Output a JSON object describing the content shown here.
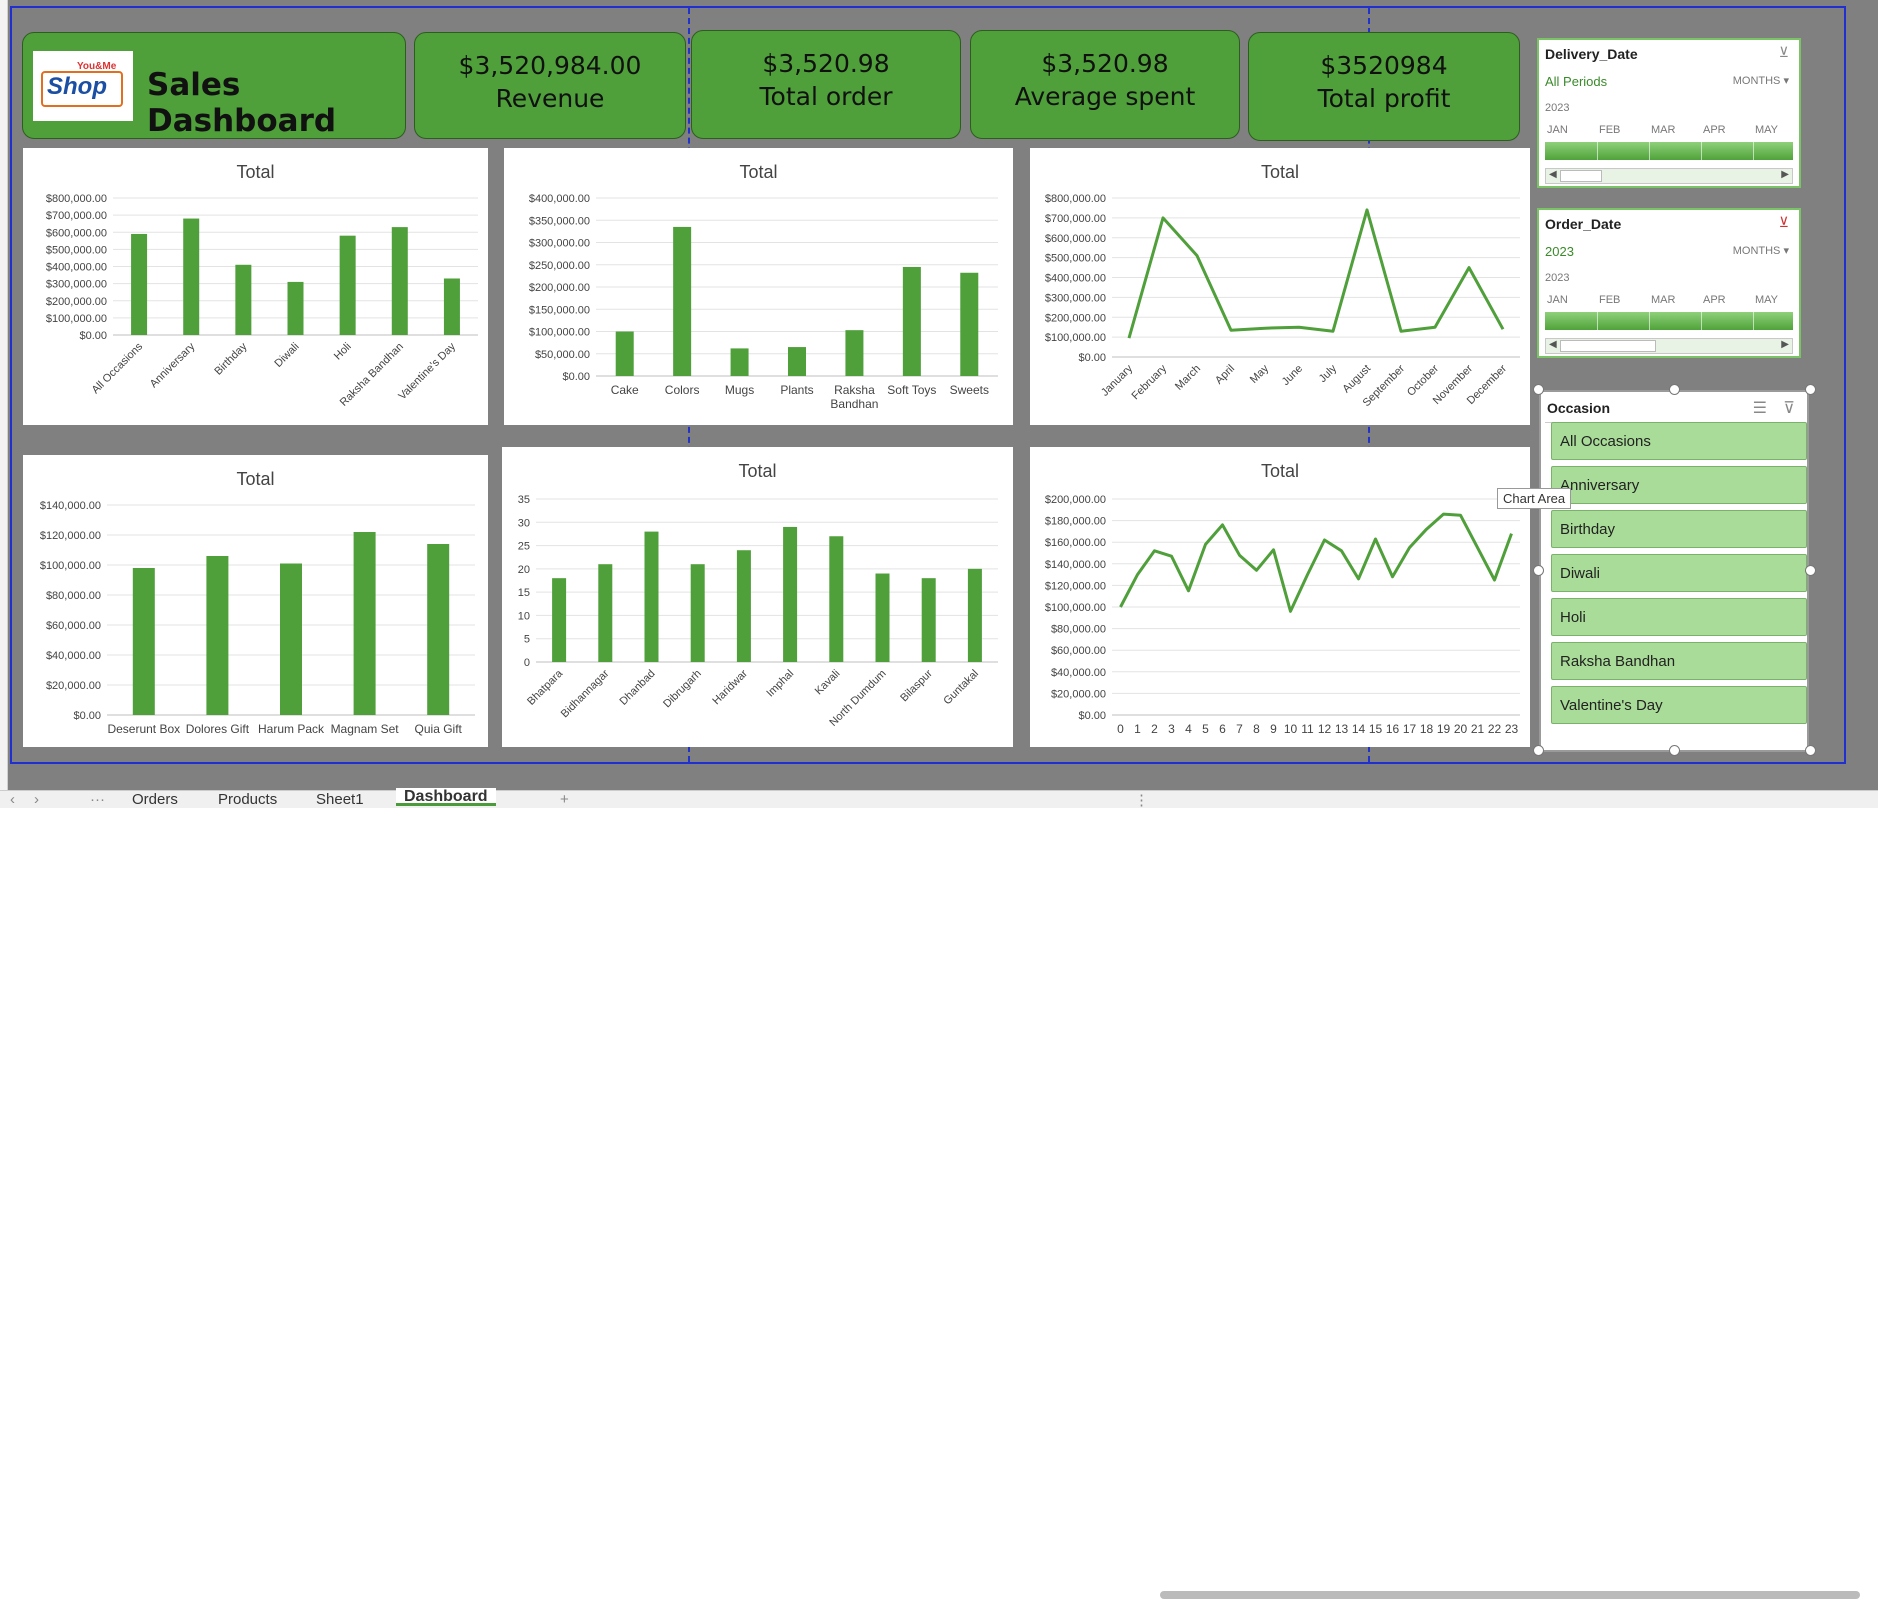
{
  "header": {
    "title": "Sales Dashboard",
    "logo_text_small": "You&Me",
    "logo_text": "Shop",
    "kpis": [
      {
        "value": "$3,520,984.00",
        "label": "Revenue"
      },
      {
        "value": "$3,520.98",
        "label": "Total order"
      },
      {
        "value": "$3,520.98",
        "label": "Average spent"
      },
      {
        "value": "$3520984",
        "label": "Total profit"
      }
    ]
  },
  "chart_data": [
    {
      "type": "bar",
      "title": "Total",
      "categories": [
        "All Occasions",
        "Anniversary",
        "Birthday",
        "Diwali",
        "Holi",
        "Raksha Bandhan",
        "Valentine's Day"
      ],
      "values": [
        590000,
        680000,
        410000,
        310000,
        580000,
        630000,
        330000
      ],
      "ylim": [
        0,
        800000
      ],
      "yticks": [
        "$0.00",
        "$100,000.00",
        "$200,000.00",
        "$300,000.00",
        "$400,000.00",
        "$500,000.00",
        "$600,000.00",
        "$700,000.00",
        "$800,000.00"
      ],
      "color": "#4f9f3a"
    },
    {
      "type": "bar",
      "title": "Total",
      "categories": [
        "Cake",
        "Colors",
        "Mugs",
        "Plants",
        "Raksha Bandhan",
        "Soft Toys",
        "Sweets"
      ],
      "values": [
        100000,
        335000,
        62000,
        65000,
        103000,
        245000,
        232000
      ],
      "ylim": [
        0,
        400000
      ],
      "yticks": [
        "$0.00",
        "$50,000.00",
        "$100,000.00",
        "$150,000.00",
        "$200,000.00",
        "$250,000.00",
        "$300,000.00",
        "$350,000.00",
        "$400,000.00"
      ],
      "color": "#4f9f3a"
    },
    {
      "type": "line",
      "title": "Total",
      "categories": [
        "January",
        "February",
        "March",
        "April",
        "May",
        "June",
        "July",
        "August",
        "September",
        "October",
        "November",
        "December"
      ],
      "values": [
        95000,
        700000,
        510000,
        135000,
        145000,
        150000,
        130000,
        740000,
        130000,
        150000,
        450000,
        140000
      ],
      "ylim": [
        0,
        800000
      ],
      "yticks": [
        "$0.00",
        "$100,000.00",
        "$200,000.00",
        "$300,000.00",
        "$400,000.00",
        "$500,000.00",
        "$600,000.00",
        "$700,000.00",
        "$800,000.00"
      ],
      "color": "#4f9f3a"
    },
    {
      "type": "bar",
      "title": "Total",
      "categories": [
        "Deserunt Box",
        "Dolores Gift",
        "Harum Pack",
        "Magnam Set",
        "Quia Gift"
      ],
      "values": [
        98000,
        106000,
        101000,
        122000,
        114000
      ],
      "ylim": [
        0,
        140000
      ],
      "yticks": [
        "$0.00",
        "$20,000.00",
        "$40,000.00",
        "$60,000.00",
        "$80,000.00",
        "$100,000.00",
        "$120,000.00",
        "$140,000.00"
      ],
      "color": "#4f9f3a"
    },
    {
      "type": "bar",
      "title": "Total",
      "categories": [
        "Bhatpara",
        "Bidhannagar",
        "Dhanbad",
        "Dibrugarh",
        "Haridwar",
        "Imphal",
        "Kavali",
        "North Dumdum",
        "Bilaspur",
        "Guntakal"
      ],
      "values": [
        18,
        21,
        28,
        21,
        24,
        29,
        27,
        19,
        18,
        20
      ],
      "ylim": [
        0,
        35
      ],
      "yticks": [
        "0",
        "5",
        "10",
        "15",
        "20",
        "25",
        "30",
        "35"
      ],
      "color": "#4f9f3a"
    },
    {
      "type": "line",
      "title": "Total",
      "categories": [
        "0",
        "1",
        "2",
        "3",
        "4",
        "5",
        "6",
        "7",
        "8",
        "9",
        "10",
        "11",
        "12",
        "13",
        "14",
        "15",
        "16",
        "17",
        "18",
        "19",
        "20",
        "21",
        "22",
        "23"
      ],
      "values": [
        100000,
        130000,
        152000,
        147000,
        115000,
        158000,
        176000,
        148000,
        134000,
        153000,
        96000,
        130000,
        162000,
        152000,
        126000,
        163000,
        128000,
        155000,
        172000,
        186000,
        185000,
        155000,
        125000,
        168000
      ],
      "ylim": [
        0,
        200000
      ],
      "yticks": [
        "$0.00",
        "$20,000.00",
        "$40,000.00",
        "$60,000.00",
        "$80,000.00",
        "$100,000.00",
        "$120,000.00",
        "$140,000.00",
        "$160,000.00",
        "$180,000.00",
        "$200,000.00"
      ],
      "color": "#4f9f3a"
    }
  ],
  "slicers": {
    "delivery": {
      "title": "Delivery_Date",
      "period": "All Periods",
      "level": "MONTHS",
      "year": "2023",
      "months": [
        "JAN",
        "FEB",
        "MAR",
        "APR",
        "MAY"
      ]
    },
    "order": {
      "title": "Order_Date",
      "period": "2023",
      "level": "MONTHS",
      "year": "2023",
      "months": [
        "JAN",
        "FEB",
        "MAR",
        "APR",
        "MAY"
      ]
    },
    "occasion": {
      "title": "Occasion",
      "items": [
        "All Occasions",
        "Anniversary",
        "Birthday",
        "Diwali",
        "Holi",
        "Raksha Bandhan",
        "Valentine's Day"
      ]
    }
  },
  "tooltip": "Chart Area",
  "tabs": [
    "Orders",
    "Products",
    "Sheet1",
    "Dashboard"
  ],
  "active_tab": "Dashboard",
  "colors": {
    "accent": "#4f9f3a",
    "background": "#808080",
    "selection": "#1f2fd0"
  }
}
